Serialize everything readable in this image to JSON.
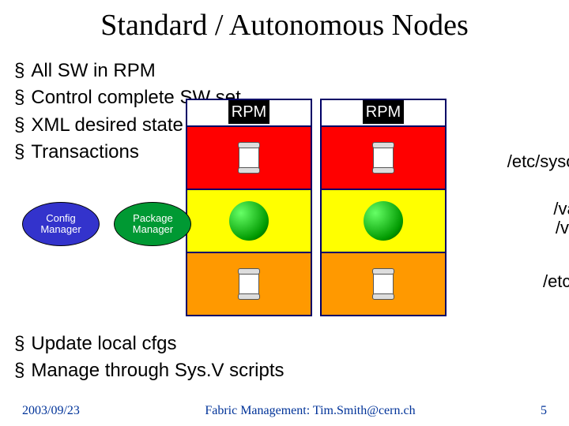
{
  "title": "Standard / Autonomous Nodes",
  "bullets_top": {
    "0": "All SW in RPM",
    "1": "Control complete SW set",
    "2": "XML desired state",
    "3": "Transactions"
  },
  "bullets_bottom": {
    "0": "Update local cfgs",
    "1": "Manage through Sys.V scripts"
  },
  "columns": {
    "head": "RPM"
  },
  "axis": {
    "red_a": "/etc",
    "red_b": "/etc/sysconfig",
    "yellow_a": "/var/run",
    "yellow_b": "/var/log",
    "orange": "/etc/init.d"
  },
  "ovals": {
    "config_a": "Config",
    "config_b": "Manager",
    "package_a": "Package",
    "package_b": "Manager"
  },
  "footer": {
    "date": "2003/09/23",
    "center": "Fabric Management: Tim.Smith@cern.ch",
    "slide": "5"
  }
}
